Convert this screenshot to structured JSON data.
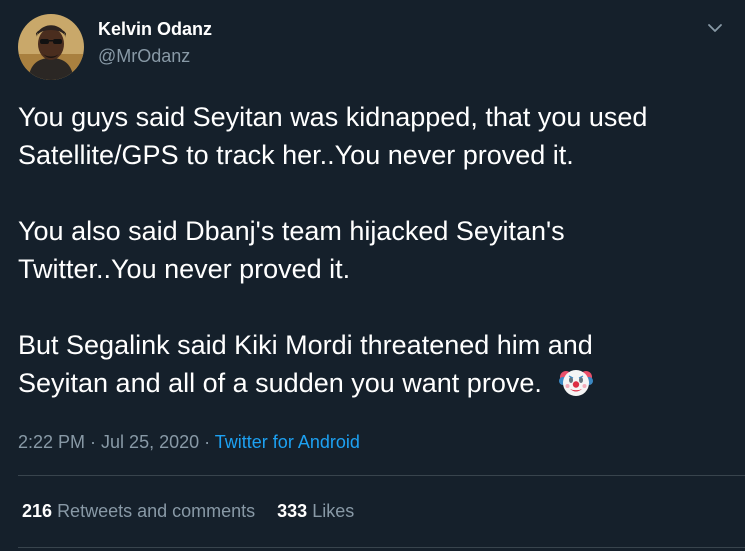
{
  "user": {
    "name": "Kelvin Odanz",
    "handle": "@MrOdanz",
    "avatar_icon": "profile-photo"
  },
  "tweet": {
    "paragraphs": [
      [
        "You guys said Seyitan was kidnapped, that you used",
        "Satellite/GPS to track her..You never proved it."
      ],
      [
        "You also said Dbanj's team hijacked Seyitan's",
        "Twitter..You never proved it."
      ],
      [
        "But Segalink said Kiki Mordi threatened him and",
        "Seyitan and all of a sudden you want prove."
      ]
    ],
    "emoji": "clown-face"
  },
  "meta": {
    "time": "2:22 PM",
    "sep1": " · ",
    "date": "Jul 25, 2020",
    "sep2": " · ",
    "source": "Twitter for Android"
  },
  "stats": {
    "retweets_count": "216",
    "retweets_label": "Retweets and comments",
    "likes_count": "333",
    "likes_label": "Likes"
  },
  "colors": {
    "background": "#15202b",
    "text": "#ffffff",
    "secondary": "#8899a6",
    "link": "#1da1f2",
    "divider": "#38444d"
  },
  "icons": {
    "menu": "chevron-down-icon"
  }
}
